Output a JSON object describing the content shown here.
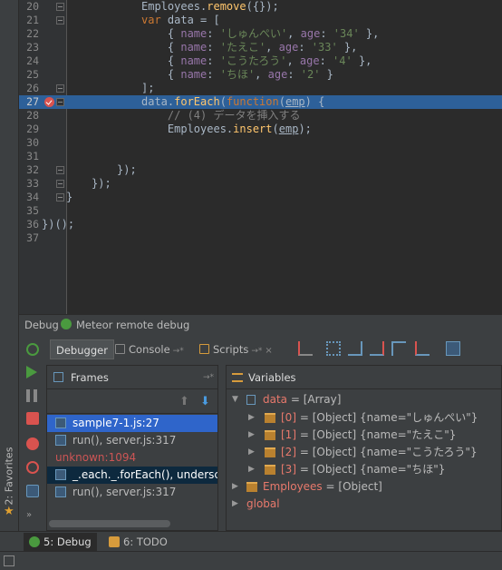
{
  "editor": {
    "lines": [
      {
        "n": "20",
        "segments": [
          [
            "plain",
            "Employees."
          ],
          [
            "fn",
            "remove"
          ],
          [
            "plain",
            "({});"
          ]
        ]
      },
      {
        "n": "21",
        "segments": [
          [
            "kw",
            "var "
          ],
          [
            "plain",
            "data = ["
          ]
        ]
      },
      {
        "n": "22",
        "segments": [
          [
            "plain",
            "    { "
          ],
          [
            "prop",
            "name"
          ],
          [
            "plain",
            ": "
          ],
          [
            "str",
            "'しゅんぺい'"
          ],
          [
            "plain",
            ", "
          ],
          [
            "prop",
            "age"
          ],
          [
            "plain",
            ": "
          ],
          [
            "str",
            "'34'"
          ],
          [
            "plain",
            " },"
          ]
        ]
      },
      {
        "n": "23",
        "segments": [
          [
            "plain",
            "    { "
          ],
          [
            "prop",
            "name"
          ],
          [
            "plain",
            ": "
          ],
          [
            "str",
            "'たえこ'"
          ],
          [
            "plain",
            ", "
          ],
          [
            "prop",
            "age"
          ],
          [
            "plain",
            ": "
          ],
          [
            "str",
            "'33'"
          ],
          [
            "plain",
            " },"
          ]
        ]
      },
      {
        "n": "24",
        "segments": [
          [
            "plain",
            "    { "
          ],
          [
            "prop",
            "name"
          ],
          [
            "plain",
            ": "
          ],
          [
            "str",
            "'こうたろう'"
          ],
          [
            "plain",
            ", "
          ],
          [
            "prop",
            "age"
          ],
          [
            "plain",
            ": "
          ],
          [
            "str",
            "'4'"
          ],
          [
            "plain",
            " },"
          ]
        ]
      },
      {
        "n": "25",
        "segments": [
          [
            "plain",
            "    { "
          ],
          [
            "prop",
            "name"
          ],
          [
            "plain",
            ": "
          ],
          [
            "str",
            "'ちほ'"
          ],
          [
            "plain",
            ", "
          ],
          [
            "prop",
            "age"
          ],
          [
            "plain",
            ": "
          ],
          [
            "str",
            "'2'"
          ],
          [
            "plain",
            " }"
          ]
        ]
      },
      {
        "n": "26",
        "segments": [
          [
            "plain",
            "];"
          ]
        ]
      },
      {
        "n": "27",
        "segments": [
          [
            "plain",
            "data."
          ],
          [
            "fn",
            "forEach"
          ],
          [
            "plain",
            "("
          ],
          [
            "kw",
            "function"
          ],
          [
            "plain",
            "("
          ],
          [
            "param",
            "emp"
          ],
          [
            "plain",
            ") {"
          ]
        ]
      },
      {
        "n": "28",
        "segments": [
          [
            "cmt",
            "    // (4) データを挿入する"
          ]
        ]
      },
      {
        "n": "29",
        "segments": [
          [
            "plain",
            "    Employees."
          ],
          [
            "fn",
            "insert"
          ],
          [
            "plain",
            "("
          ],
          [
            "param",
            "emp"
          ],
          [
            "plain",
            ");"
          ]
        ]
      },
      {
        "n": "30",
        "segments": []
      },
      {
        "n": "31",
        "segments": []
      },
      {
        "n": "32",
        "segments": [
          [
            "plain",
            "});"
          ]
        ]
      },
      {
        "n": "33",
        "segments": [
          [
            "plain",
            "});"
          ]
        ]
      },
      {
        "n": "34",
        "segments": [
          [
            "plain",
            "}"
          ]
        ]
      },
      {
        "n": "35",
        "segments": []
      },
      {
        "n": "36",
        "segments": [
          [
            "plain",
            "})();"
          ]
        ]
      },
      {
        "n": "37",
        "segments": []
      }
    ]
  },
  "debug": {
    "title": "Debug",
    "config": "Meteor remote debug",
    "tabs": {
      "debugger": "Debugger",
      "console": "Console",
      "scripts": "Scripts"
    },
    "pin": "→*",
    "close": "×"
  },
  "frames": {
    "title": "Frames",
    "pin": "→*",
    "up": "⬆",
    "down": "⬇",
    "rows": [
      {
        "text": "sample7-1.js:27",
        "kind": "sel"
      },
      {
        "text": "run(), server.js:317",
        "kind": "normal"
      },
      {
        "text": "unknown:1094",
        "kind": "unk"
      },
      {
        "text": "_.each._.forEach(), underscore",
        "kind": "sel2"
      },
      {
        "text": "run(), server.js:317",
        "kind": "normal"
      }
    ]
  },
  "variables": {
    "title": "Variables",
    "data_name": "data",
    "data_value": "= [Array]",
    "items": [
      {
        "name": "[0]",
        "value": "= [Object] {name=\"しゅんぺい\"}"
      },
      {
        "name": "[1]",
        "value": "= [Object] {name=\"たえこ\"}"
      },
      {
        "name": "[2]",
        "value": "= [Object] {name=\"こうたろう\"}"
      },
      {
        "name": "[3]",
        "value": "= [Object] {name=\"ちほ\"}"
      }
    ],
    "employees_name": "Employees",
    "employees_value": "= [Object]",
    "global_name": "global"
  },
  "left_strip": {
    "favorites": "2: Favorites"
  },
  "bottom": {
    "debug_tab": "5: Debug",
    "todo_tab": "6: TODO"
  },
  "colors": {
    "accent": "#2d6099",
    "selection": "#2f65ca",
    "breakpoint": "#d9534f"
  }
}
